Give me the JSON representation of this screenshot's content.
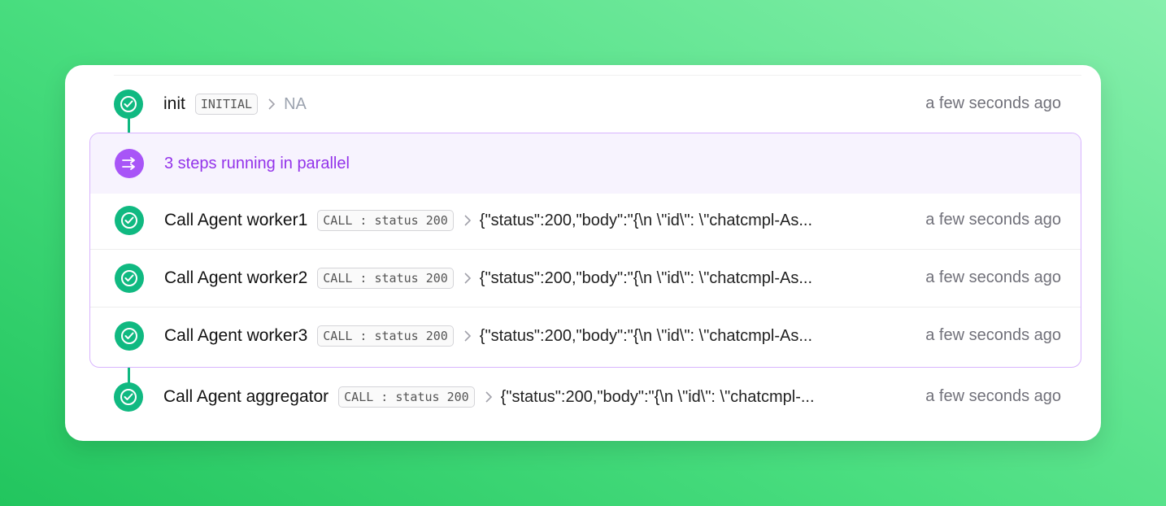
{
  "steps": {
    "init": {
      "name": "init",
      "badge": "INITIAL",
      "output": "NA",
      "time": "a few seconds ago"
    },
    "parallel": {
      "label": "3 steps running in parallel",
      "workers": [
        {
          "name": "Call Agent worker1",
          "badge": "CALL : status 200",
          "output": "{\"status\":200,\"body\":\"{\\n \\\"id\\\": \\\"chatcmpl-As...",
          "time": "a few seconds ago"
        },
        {
          "name": "Call Agent worker2",
          "badge": "CALL : status 200",
          "output": "{\"status\":200,\"body\":\"{\\n \\\"id\\\": \\\"chatcmpl-As...",
          "time": "a few seconds ago"
        },
        {
          "name": "Call Agent worker3",
          "badge": "CALL : status 200",
          "output": "{\"status\":200,\"body\":\"{\\n \\\"id\\\": \\\"chatcmpl-As...",
          "time": "a few seconds ago"
        }
      ]
    },
    "aggregator": {
      "name": "Call Agent aggregator",
      "badge": "CALL : status 200",
      "output": "{\"status\":200,\"body\":\"{\\n \\\"id\\\": \\\"chatcmpl-...",
      "time": "a few seconds ago"
    }
  },
  "icons": {
    "success": "check-circle-icon",
    "parallel": "parallel-arrows-icon",
    "separator": "chevron-right-icon"
  },
  "colors": {
    "success": "#10b981",
    "parallel": "#a855f7",
    "parallel_text": "#9333ea",
    "parallel_bg": "#f7f3fe"
  }
}
